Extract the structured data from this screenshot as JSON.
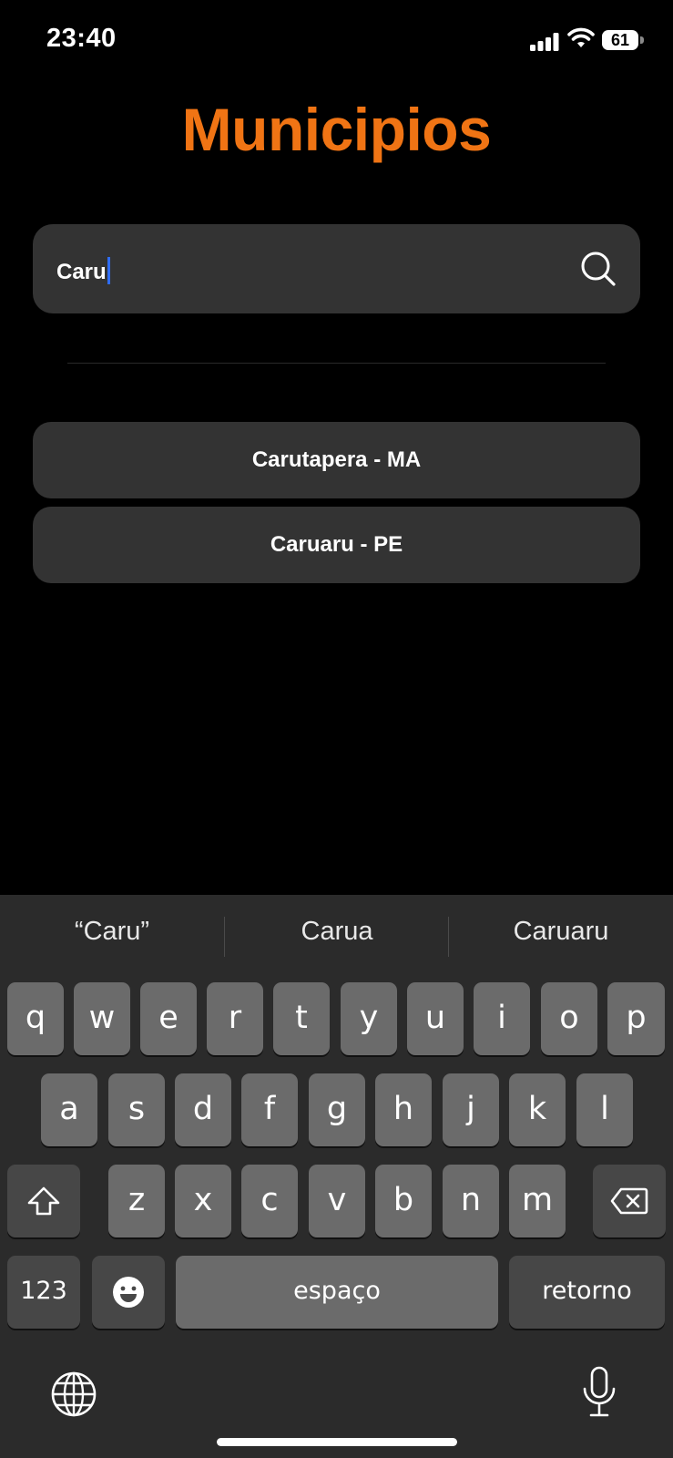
{
  "status_bar": {
    "time": "23:40",
    "battery": "61",
    "icons": [
      "cellular-signal-icon",
      "wifi-icon",
      "battery-icon"
    ]
  },
  "title": "Municipios",
  "search": {
    "value": "Caru",
    "icon": "search-icon"
  },
  "results": [
    {
      "label": "Carutapera - MA"
    },
    {
      "label": "Caruaru - PE"
    }
  ],
  "keyboard": {
    "suggestions": [
      "“Caru”",
      "Carua",
      "Caruaru"
    ],
    "row1": [
      "q",
      "w",
      "e",
      "r",
      "t",
      "y",
      "u",
      "i",
      "o",
      "p"
    ],
    "row2": [
      "a",
      "s",
      "d",
      "f",
      "g",
      "h",
      "j",
      "k",
      "l"
    ],
    "row3": [
      "z",
      "x",
      "c",
      "v",
      "b",
      "n",
      "m"
    ],
    "numbers_key": "123",
    "space_key": "espaço",
    "return_key": "retorno",
    "icons": [
      "shift-icon",
      "backspace-icon",
      "emoji-icon",
      "globe-icon",
      "microphone-icon"
    ]
  },
  "colors": {
    "accent": "#F07414",
    "background": "#000000",
    "field": "#333333",
    "caret": "#2F6DF5",
    "keyboard": "#2B2B2B",
    "key": "#6B6B6B",
    "key_dark": "#474747"
  }
}
